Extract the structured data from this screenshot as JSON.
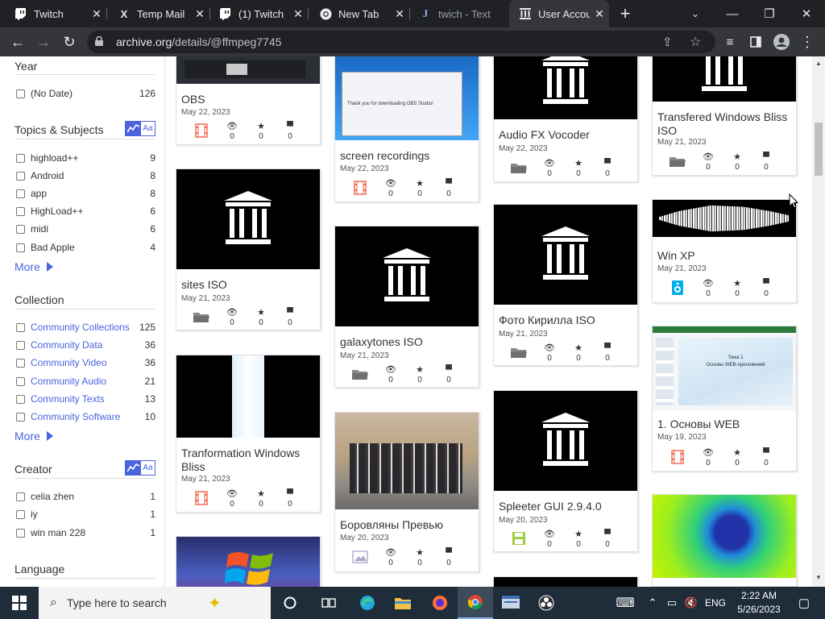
{
  "browser": {
    "tabs": [
      {
        "title": "Twitch",
        "icon": "twitch-icon"
      },
      {
        "title": "Temp Mail",
        "icon": "x-icon"
      },
      {
        "title": "(1) Twitch",
        "icon": "twitch-icon"
      },
      {
        "title": "New Tab",
        "icon": "chrome-icon"
      },
      {
        "title": "twich - Text",
        "icon": "j-icon"
      },
      {
        "title": "User Accou",
        "icon": "archive-icon"
      }
    ],
    "url_host": "archive.org",
    "url_path": "/details/@ffmpeg7745"
  },
  "sidebar": {
    "year": {
      "heading": "Year",
      "items": [
        {
          "label": "(No Date)",
          "count": "126"
        }
      ]
    },
    "topics": {
      "heading": "Topics & Subjects",
      "toggle_label": "Aa",
      "items": [
        {
          "label": "highload++",
          "count": "9"
        },
        {
          "label": "Android",
          "count": "8"
        },
        {
          "label": "app",
          "count": "8"
        },
        {
          "label": "HighLoad++",
          "count": "6"
        },
        {
          "label": "midi",
          "count": "6"
        },
        {
          "label": "Bad Apple",
          "count": "4"
        }
      ],
      "more": "More"
    },
    "collection": {
      "heading": "Collection",
      "items": [
        {
          "label": "Community Collections",
          "count": "125"
        },
        {
          "label": "Community Data",
          "count": "36"
        },
        {
          "label": "Community Video",
          "count": "36"
        },
        {
          "label": "Community Audio",
          "count": "21"
        },
        {
          "label": "Community Texts",
          "count": "13"
        },
        {
          "label": "Community Software",
          "count": "10"
        }
      ],
      "more": "More"
    },
    "creator": {
      "heading": "Creator",
      "toggle_label": "Aa",
      "items": [
        {
          "label": "celia zhen",
          "count": "1"
        },
        {
          "label": "iy",
          "count": "1"
        },
        {
          "label": "win man 228",
          "count": "1"
        }
      ]
    },
    "language": {
      "heading": "Language"
    }
  },
  "tiles": [
    {
      "title": "OBS",
      "date": "May 22, 2023",
      "type": "movies",
      "views": "0",
      "favs": "0",
      "reviews": "0"
    },
    {
      "title": "sites ISO",
      "date": "May 21, 2023",
      "type": "folder",
      "views": "0",
      "favs": "0",
      "reviews": "0"
    },
    {
      "title": "Tranformation Windows Bliss",
      "date": "May 21, 2023",
      "type": "movies",
      "views": "0",
      "favs": "0",
      "reviews": "0"
    },
    {
      "title": "screen recordings",
      "date": "May 22, 2023",
      "type": "movies",
      "views": "0",
      "favs": "0",
      "reviews": "0"
    },
    {
      "title": "galaxytones ISO",
      "date": "May 21, 2023",
      "type": "folder",
      "views": "0",
      "favs": "0",
      "reviews": "0"
    },
    {
      "title": "Боровляны Превью",
      "date": "May 20, 2023",
      "type": "image",
      "views": "0",
      "favs": "0",
      "reviews": "0"
    },
    {
      "title": "Audio FX Vocoder",
      "date": "May 22, 2023",
      "type": "folder",
      "views": "0",
      "favs": "0",
      "reviews": "0"
    },
    {
      "title": "Фото Кирилла ISO",
      "date": "May 21, 2023",
      "type": "folder",
      "views": "0",
      "favs": "0",
      "reviews": "0"
    },
    {
      "title": "Spleeter GUI 2.9.4.0",
      "date": "May 20, 2023",
      "type": "software",
      "views": "0",
      "favs": "0",
      "reviews": "0"
    },
    {
      "title": "Transfered Windows Bliss ISO",
      "date": "May 21, 2023",
      "type": "folder",
      "views": "0",
      "favs": "0",
      "reviews": "0"
    },
    {
      "title": "Win XP",
      "date": "May 21, 2023",
      "type": "audio",
      "views": "0",
      "favs": "0",
      "reviews": "0"
    },
    {
      "title": "1. Основы WEB",
      "date": "May 19, 2023",
      "type": "movies",
      "views": "0",
      "favs": "0",
      "reviews": "0"
    }
  ],
  "slide_text": {
    "line1": "Тема 1",
    "line2": "Основы WEB-приложений"
  },
  "obs_text": "Thank you for downloading OBS Studio!",
  "taskbar": {
    "search_placeholder": "Type here to search",
    "lang": "ENG",
    "time": "2:22 AM",
    "date": "5/26/2023"
  },
  "colors": {
    "accent": "#4b64de",
    "movies": "#f1644b",
    "folder": "#888888",
    "audio": "#00adef",
    "software": "#9ecc42",
    "image": "#aaaacc"
  }
}
